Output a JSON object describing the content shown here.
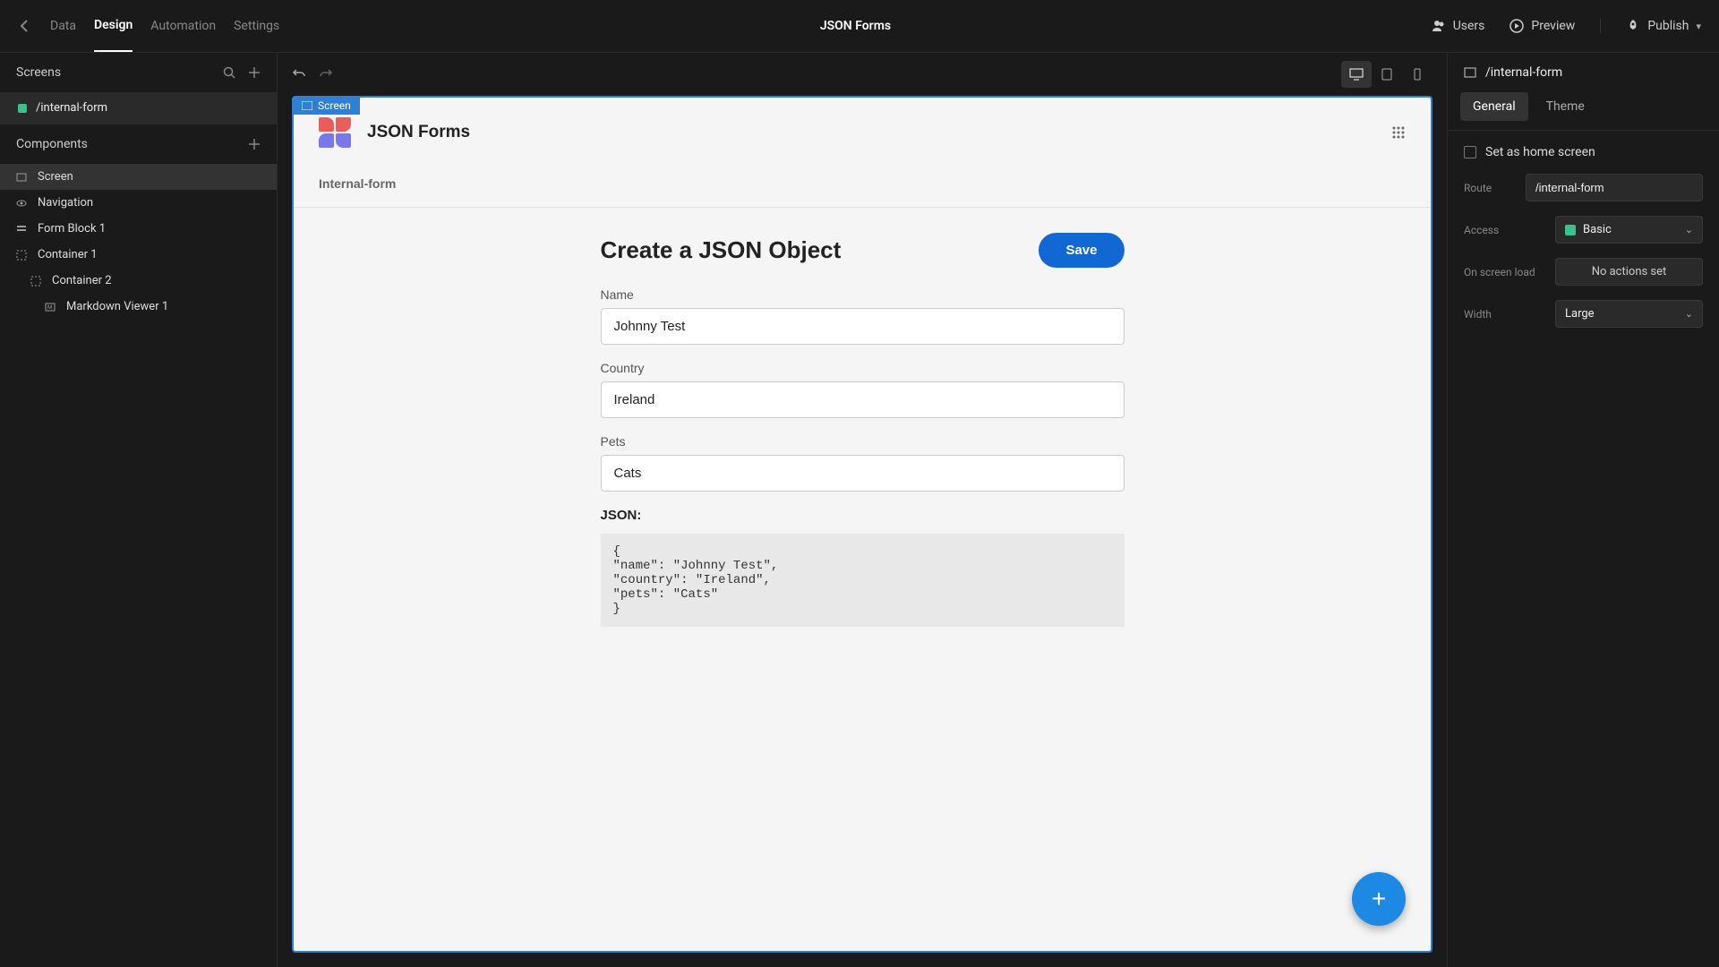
{
  "topbar": {
    "tabs": {
      "data": "Data",
      "design": "Design",
      "automation": "Automation",
      "settings": "Settings"
    },
    "title": "JSON Forms",
    "actions": {
      "users": "Users",
      "preview": "Preview",
      "publish": "Publish"
    }
  },
  "leftSidebar": {
    "screensLabel": "Screens",
    "screenItem": "/internal-form",
    "componentsLabel": "Components",
    "tree": {
      "screen": "Screen",
      "navigation": "Navigation",
      "formBlock": "Form Block 1",
      "container1": "Container 1",
      "container2": "Container 2",
      "markdown": "Markdown Viewer 1"
    }
  },
  "canvas": {
    "badge": "Screen",
    "appTitle": "JSON Forms",
    "breadcrumb": "Internal-form",
    "formHeading": "Create a JSON Object",
    "saveBtn": "Save",
    "fields": {
      "nameLabel": "Name",
      "nameValue": "Johnny Test",
      "countryLabel": "Country",
      "countryValue": "Ireland",
      "petsLabel": "Pets",
      "petsValue": "Cats"
    },
    "jsonLabel": "JSON:",
    "jsonBody": "{\n\"name\": \"Johnny Test\",\n\"country\": \"Ireland\",\n\"pets\": \"Cats\"\n}"
  },
  "rightSidebar": {
    "header": "/internal-form",
    "tabs": {
      "general": "General",
      "theme": "Theme"
    },
    "homeScreen": "Set as home screen",
    "routeLabel": "Route",
    "routeValue": "/internal-form",
    "accessLabel": "Access",
    "accessValue": "Basic",
    "onLoadLabel": "On screen load",
    "onLoadValue": "No actions set",
    "widthLabel": "Width",
    "widthValue": "Large"
  }
}
